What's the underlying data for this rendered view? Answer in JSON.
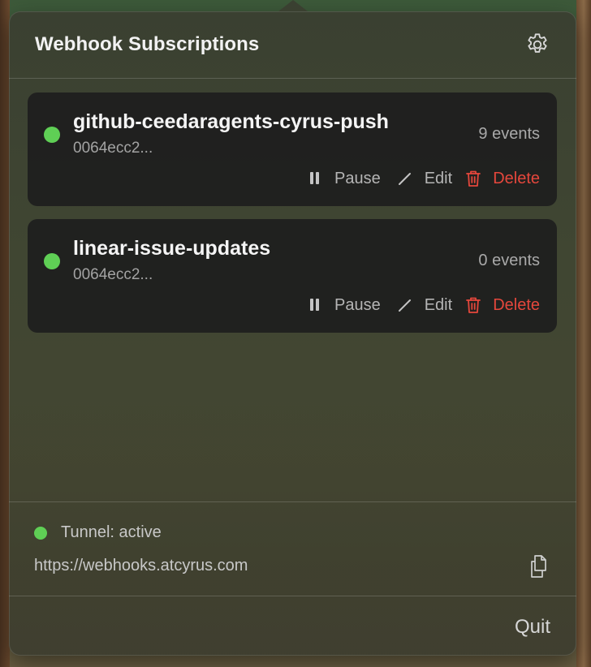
{
  "header": {
    "title": "Webhook Subscriptions",
    "settings_icon": "gear-icon"
  },
  "subscriptions": [
    {
      "status": "active",
      "status_color": "#5fcf55",
      "name": "github-ceedaragents-cyrus-push",
      "id": "0064ecc2...",
      "events": "9 events",
      "pause_label": "Pause",
      "edit_label": "Edit",
      "delete_label": "Delete"
    },
    {
      "status": "active",
      "status_color": "#5fcf55",
      "name": "linear-issue-updates",
      "id": "0064ecc2...",
      "events": "0 events",
      "pause_label": "Pause",
      "edit_label": "Edit",
      "delete_label": "Delete"
    }
  ],
  "footer": {
    "tunnel_status": "Tunnel: active",
    "tunnel_url": "https://webhooks.atcyrus.com",
    "copy_icon": "copy-icon",
    "quit_label": "Quit"
  },
  "colors": {
    "accent_green": "#5fcf55",
    "danger_red": "#e5473c"
  }
}
